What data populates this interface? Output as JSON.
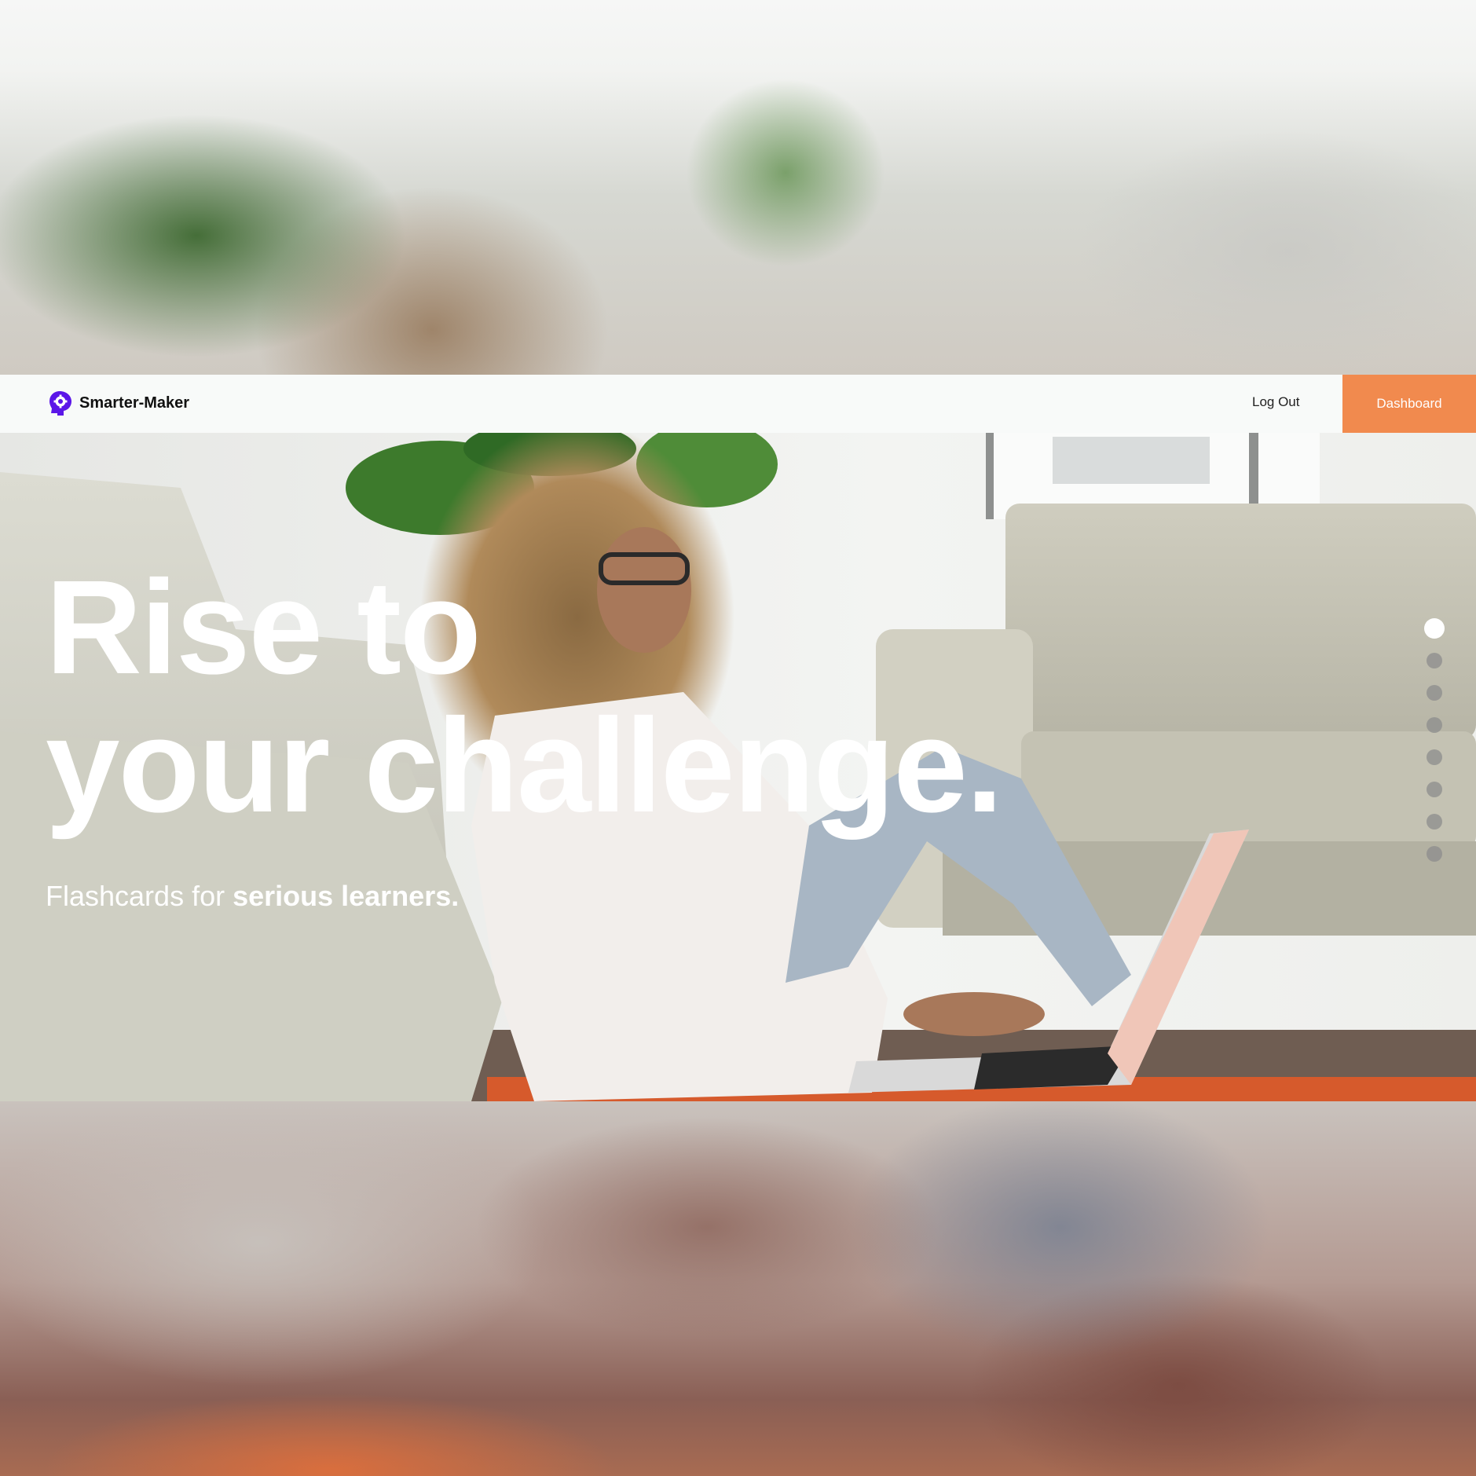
{
  "navbar": {
    "brand_name": "Smarter-Maker",
    "brand_icon": "brain-gear-icon",
    "logout_label": "Log Out",
    "dashboard_label": "Dashboard"
  },
  "hero": {
    "headline_line1": "Rise to",
    "headline_line2": "your challenge.",
    "subhead_prefix": "Flashcards for ",
    "subhead_emphasis": "serious learners.",
    "slider": {
      "total": 8,
      "active_index": 0
    }
  },
  "colors": {
    "accent": "#f18a4e",
    "brand_icon": "#5b16e8",
    "navbar_bg": "#f8faf9"
  }
}
